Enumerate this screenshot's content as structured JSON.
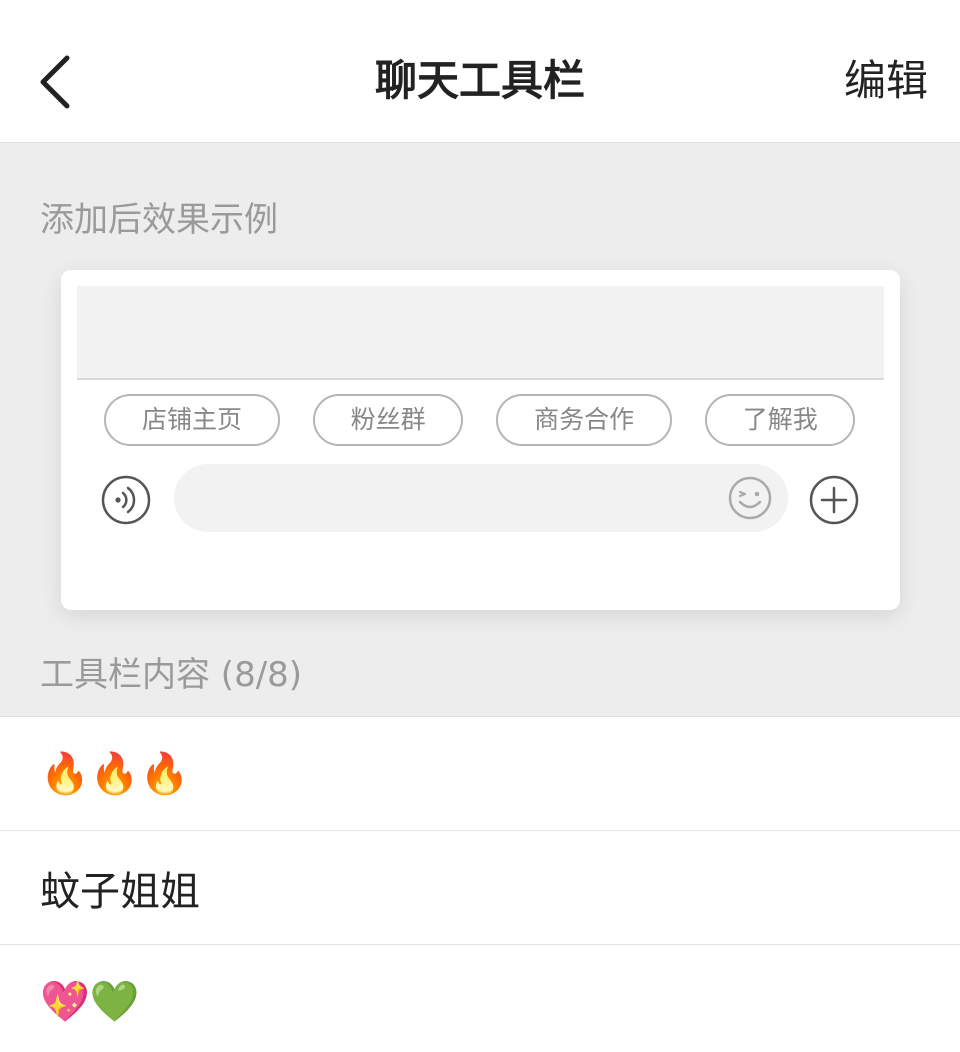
{
  "header": {
    "title": "聊天工具栏",
    "edit_label": "编辑"
  },
  "preview": {
    "label": "添加后效果示例",
    "chips": [
      "店铺主页",
      "粉丝群",
      "商务合作",
      "了解我"
    ]
  },
  "toolbar": {
    "label": "工具栏内容 (8/8)",
    "items": [
      "🔥🔥🔥",
      "蚊子姐姐",
      "💖💚"
    ]
  },
  "colors": {
    "background": "#ededed",
    "label_gray": "#9a9a9a",
    "chip_border": "#b5b5b5"
  },
  "icons": {
    "back": "chevron-left-icon",
    "voice": "voice-icon",
    "emoji": "smile-icon",
    "plus": "plus-circle-icon"
  }
}
